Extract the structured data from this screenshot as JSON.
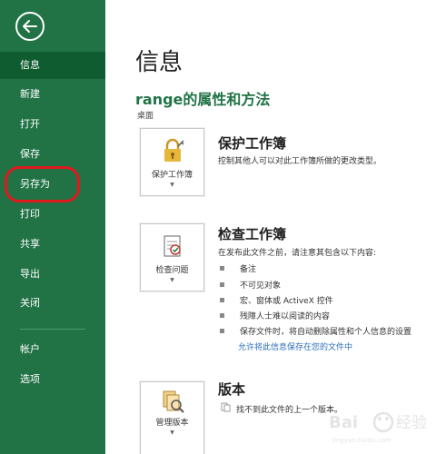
{
  "sidebar": {
    "items": [
      {
        "label": "信息",
        "active": true
      },
      {
        "label": "新建"
      },
      {
        "label": "打开"
      },
      {
        "label": "保存"
      },
      {
        "label": "另存为",
        "highlighted": true
      },
      {
        "label": "打印"
      },
      {
        "label": "共享"
      },
      {
        "label": "导出"
      },
      {
        "label": "关闭"
      },
      {
        "label": "帐户"
      },
      {
        "label": "选项"
      }
    ]
  },
  "main": {
    "title": "信息",
    "doc_name": "range的属性和方法",
    "doc_path": "桌面",
    "protect": {
      "tile_label": "保护工作簿",
      "title": "保护工作簿",
      "desc": "控制其他人可以对此工作簿所做的更改类型。"
    },
    "inspect": {
      "tile_label": "检查问题",
      "title": "检查工作簿",
      "desc": "在发布此文件之前，请注意其包含以下内容:",
      "bullets": [
        "备注",
        "不可见对象",
        "宏、窗体或 ActiveX 控件",
        "残障人士难以阅读的内容",
        "保存文件时，将自动删除属性和个人信息的设置"
      ],
      "link": "允许将此信息保存在您的文件中"
    },
    "version": {
      "tile_label": "管理版本",
      "title": "版本",
      "desc": "找不到此文件的上一个版本。"
    }
  },
  "colors": {
    "sidebar_bg": "#217346",
    "sidebar_active": "#0e5c2f",
    "accent": "#217346",
    "link": "#2a6ebb",
    "highlight": "#e0191e"
  }
}
